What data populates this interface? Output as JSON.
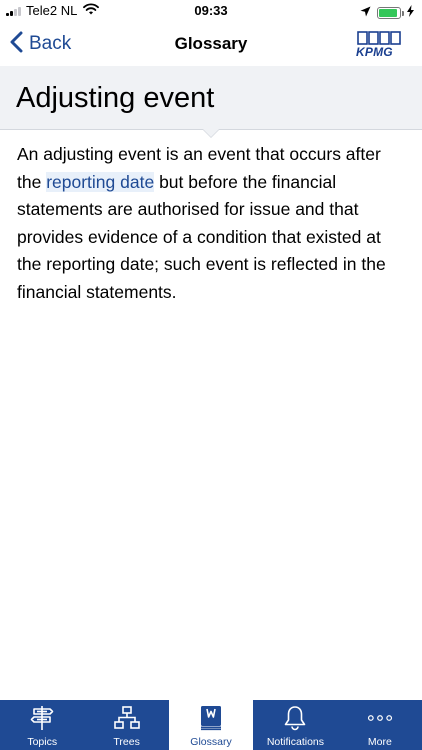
{
  "status_bar": {
    "carrier": "Tele2 NL",
    "time": "09:33",
    "icons": [
      "signal-icon",
      "wifi-icon",
      "location-icon",
      "battery-icon",
      "charging-icon"
    ],
    "battery_level_percent": 90,
    "battery_color": "#34c759"
  },
  "nav": {
    "back_label": "Back",
    "title": "Glossary",
    "logo_text": "KPMG"
  },
  "term": {
    "title": "Adjusting event",
    "definition_part1": "An adjusting event is an event that occurs after the ",
    "link_text": "reporting date",
    "definition_part2": " but before the financial statements are authorised for issue and that provides evidence of a condition that existed at the reporting date; such event is reflected in the financial statements."
  },
  "tabs": [
    {
      "label": "Topics",
      "icon": "signpost-icon",
      "active": false
    },
    {
      "label": "Trees",
      "icon": "hierarchy-icon",
      "active": false
    },
    {
      "label": "Glossary",
      "icon": "book-icon",
      "active": true
    },
    {
      "label": "Notifications",
      "icon": "bell-icon",
      "active": false
    },
    {
      "label": "More",
      "icon": "more-dots-icon",
      "active": false
    }
  ],
  "colors": {
    "accent": "#1f4a94",
    "header_bg": "#f0f2f5",
    "link_highlight": "#e8f0fa"
  }
}
